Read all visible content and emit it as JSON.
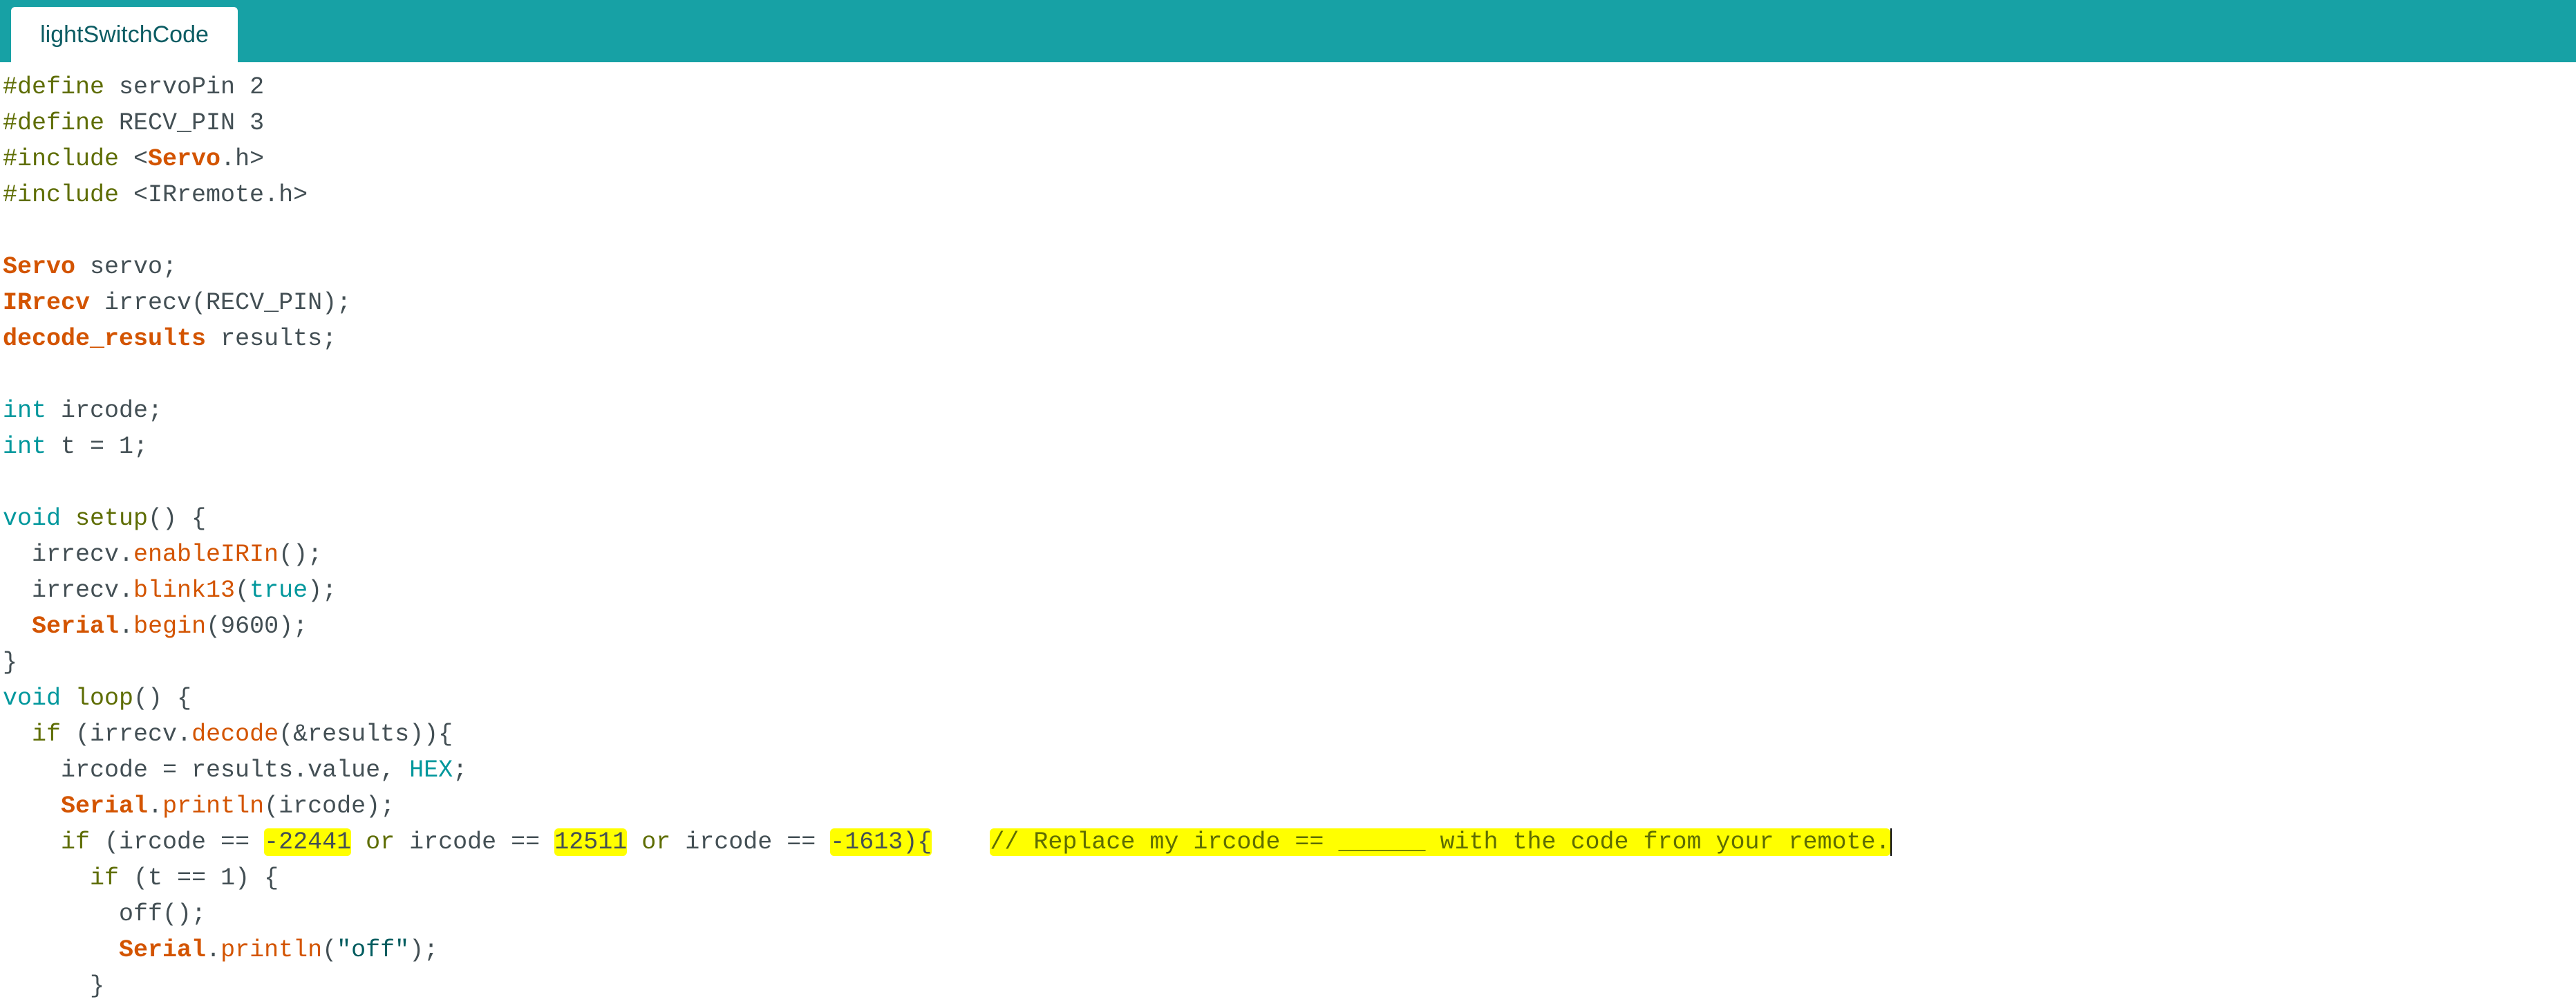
{
  "tab": {
    "title": "lightSwitchCode"
  },
  "code": {
    "l1": {
      "a": "#define",
      "b": " servoPin 2"
    },
    "l2": {
      "a": "#define",
      "b": " RECV_PIN 3"
    },
    "l3": {
      "a": "#include",
      "b": " <",
      "c": "Servo",
      "d": ".h>"
    },
    "l4": {
      "a": "#include",
      "b": " <IRremote.h>"
    },
    "l6": {
      "a": "Servo",
      "b": " servo;"
    },
    "l7": {
      "a": "IRrecv",
      "b": " irrecv(RECV_PIN);"
    },
    "l8": {
      "a": "decode_results",
      "b": " results;"
    },
    "l10": {
      "a": "int",
      "b": " ircode;"
    },
    "l11": {
      "a": "int",
      "b": " t = 1;"
    },
    "l13": {
      "a": "void",
      "b": " ",
      "c": "setup",
      "d": "() {"
    },
    "l14": {
      "a": "  irrecv.",
      "b": "enableIRIn",
      "c": "();"
    },
    "l15": {
      "a": "  irrecv.",
      "b": "blink13",
      "c": "(",
      "d": "true",
      "e": ");"
    },
    "l16": {
      "a": "  ",
      "b": "Serial",
      "c": ".",
      "d": "begin",
      "e": "(9600);"
    },
    "l17": {
      "a": "}"
    },
    "l18": {
      "a": "void",
      "b": " ",
      "c": "loop",
      "d": "() {"
    },
    "l19": {
      "a": "  ",
      "b": "if",
      "c": " (irrecv.",
      "d": "decode",
      "e": "(&results)){"
    },
    "l20": {
      "a": "    ircode = results.value, ",
      "b": "HEX",
      "c": ";"
    },
    "l21": {
      "a": "    ",
      "b": "Serial",
      "c": ".",
      "d": "println",
      "e": "(ircode);"
    },
    "l22": {
      "a": "    ",
      "b": "if",
      "c": " (ircode == ",
      "d": "-22441",
      "e": " ",
      "f": "or",
      "g": " ircode == ",
      "h": "12511",
      "i": " ",
      "j": "or",
      "k": " ircode == ",
      "l": "-1613",
      "m": "){",
      "n": "    ",
      "o": "// Replace my ircode == ______ with the code from your remote."
    },
    "l23": {
      "a": "      ",
      "b": "if",
      "c": " (t == 1) {"
    },
    "l24": {
      "a": "        off();"
    },
    "l25": {
      "a": "        ",
      "b": "Serial",
      "c": ".",
      "d": "println",
      "e": "(",
      "f": "\"off\"",
      "g": ");"
    },
    "l26": {
      "a": "      }"
    }
  },
  "colors": {
    "tab_bar": "#17a1a5",
    "tab_text": "#0b5c63",
    "type_keyword": "#00979c",
    "preprocessor": "#5e6d03",
    "class_name": "#d35400",
    "highlight": "#ffff00"
  }
}
